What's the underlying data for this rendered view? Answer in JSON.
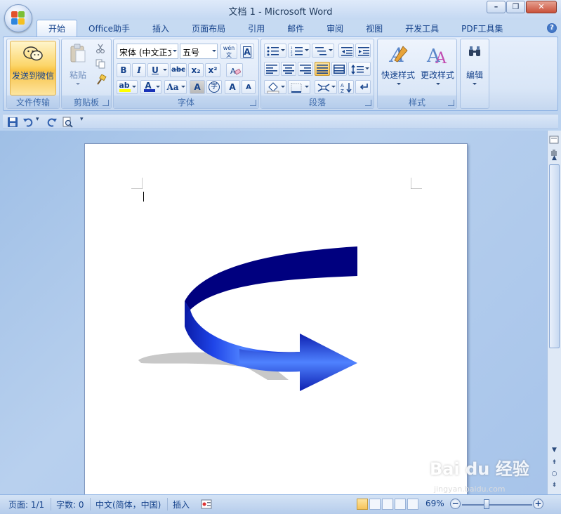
{
  "window": {
    "title": "文档 1 - Microsoft Word",
    "minimize_glyph": "–",
    "restore_glyph": "❐",
    "close_glyph": "✕"
  },
  "tabs": [
    {
      "label": "开始",
      "active": true
    },
    {
      "label": "Office助手"
    },
    {
      "label": "插入"
    },
    {
      "label": "页面布局"
    },
    {
      "label": "引用"
    },
    {
      "label": "邮件"
    },
    {
      "label": "审阅"
    },
    {
      "label": "视图"
    },
    {
      "label": "开发工具"
    },
    {
      "label": "PDF工具集"
    }
  ],
  "help_glyph": "?",
  "ribbon": {
    "groups": {
      "file_transfer": {
        "label": "文件传输",
        "send_button": "发送到微信"
      },
      "clipboard": {
        "label": "剪贴板",
        "paste": "粘贴"
      },
      "font": {
        "label": "字体",
        "font_name": "宋体 (中文正文)",
        "font_size": "五号",
        "bold": "B",
        "italic": "I",
        "underline": "U",
        "strike": "abc",
        "subscript": "x₂",
        "superscript": "x²",
        "text_effect": "A",
        "font_color": "A",
        "change_case": "Aa",
        "char_shading": "A",
        "enclose": "字",
        "grow": "A",
        "shrink": "A",
        "phonetic": "wén 文"
      },
      "paragraph": {
        "label": "段落"
      },
      "styles": {
        "label": "样式",
        "quick_styles": "快速样式",
        "change_styles": "更改样式"
      },
      "editing": {
        "label": "编辑"
      }
    }
  },
  "qat": {
    "dropdown": "▾"
  },
  "scrollbar": {
    "up": "▲",
    "down": "▼",
    "prev": "⇞",
    "browse": "○",
    "next": "⇟"
  },
  "statusbar": {
    "page": "页面: 1/1",
    "words": "字数: 0",
    "language": "中文(简体，中国)",
    "mode": "插入",
    "zoom": "69%",
    "zoom_level": 0.35,
    "minus": "−",
    "plus": "+"
  },
  "watermark": {
    "brand": "Bai du 经验",
    "sub": "jingyan.baidu.com"
  },
  "colors": {
    "arrow_dark": "#00007f",
    "arrow_light": "#3b6bff",
    "shadow": "#c8c8c8"
  }
}
